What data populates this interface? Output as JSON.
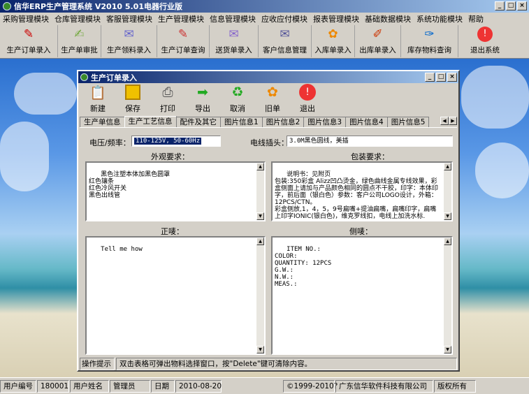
{
  "app": {
    "title": "信华ERP生产管理系统  V2010 5.01电器行业版"
  },
  "menu": [
    "采购管理模块",
    "仓库管理模块",
    "客服管理模块",
    "生产管理模块",
    "信息管理模块",
    "应收应付模块",
    "报表管理模块",
    "基础数据模块",
    "系统功能模块",
    "帮助"
  ],
  "main_toolbar": [
    {
      "label": "生产订单录入",
      "icon": "pdf-doc-icon"
    },
    {
      "label": "生产单审批",
      "icon": "approve-pen-icon"
    },
    {
      "label": "生产领料录入",
      "icon": "material-form-icon"
    },
    {
      "label": "生产订单查询",
      "icon": "order-query-icon"
    },
    {
      "label": "送货单录入",
      "icon": "delivery-form-icon"
    },
    {
      "label": "客户信息管理",
      "icon": "customer-form-icon"
    },
    {
      "label": "入库单录入",
      "icon": "stock-in-icon"
    },
    {
      "label": "出库单录入",
      "icon": "stock-out-icon"
    },
    {
      "label": "库存物料查询",
      "icon": "inventory-query-icon"
    },
    {
      "label": "退出系统",
      "icon": "exit-icon"
    }
  ],
  "window": {
    "title": "生产订单录入",
    "toolbar": [
      {
        "label": "新建",
        "icon": "clipboard-new-icon"
      },
      {
        "label": "保存",
        "icon": "floppy-save-icon"
      },
      {
        "label": "打印",
        "icon": "printer-icon"
      },
      {
        "label": "导出",
        "icon": "arrow-export-icon"
      },
      {
        "label": "取消",
        "icon": "cancel-cycle-icon"
      },
      {
        "label": "旧单",
        "icon": "old-order-icon"
      },
      {
        "label": "退出",
        "icon": "exit-icon"
      }
    ],
    "tabs": [
      "生产单信息",
      "生产工艺信息",
      "配件及其它",
      "图片信息1",
      "图片信息2",
      "图片信息3",
      "图片信息4",
      "图片信息5"
    ],
    "active_tab": "生产工艺信息",
    "form": {
      "voltage_label": "电压/频率：",
      "voltage_value": "110-125V, 50-60Hz",
      "plug_label": "电线插头：",
      "plug_value": "3.0M黑色圆线，美插",
      "appearance_label": "外观要求：",
      "appearance_text": "黑色注塑本体加黑色圆罩\n红色镶条\n红色冷风开关\n黑色出线管",
      "packaging_label": "包装要求：",
      "packaging_text": "说明书：见附页\n包装:350彩盒 Alizz凹凸烫金，绿色曲线金属专线效果，彩盒侧面上请加与产品颜色相同的圆点不干胶，印字：本体印字，前后面（银白色）参数：客户公司LOGO设计，外箱：12PCS/CTN。\n彩盒侧放,1，4，5，9号扁嘴+提油扁嘴，扁嘴印字，扁嘴上印字IONIC(银白色)，维克罗线扣，电线上加洗水标.",
      "front_label": "正唛：",
      "front_text": "Tell me how",
      "side_label": "侧唛：",
      "side_text": "ITEM NO.:\nCOLOR:\nQUANTITY: 12PCS\nG.W.:\nN.W.:\nMEAS.:"
    },
    "hint_caption": "操作提示",
    "hint_text": "双击表格可弹出物料选择窗口，按\"Delete\"键可清除内容。"
  },
  "status": {
    "user_id_label": "用户编号",
    "user_id": "180001",
    "user_name_label": "用户姓名",
    "user_name": "管理员",
    "date_label": "日期",
    "date": "2010-08-20",
    "copyright": "©1999-2010?",
    "company": "广东信华软件科技有限公司",
    "rights": "版权所有"
  },
  "colors": {
    "titlebar_start": "#0a246a",
    "titlebar_end": "#a6caf0",
    "face": "#d4d0c8"
  }
}
